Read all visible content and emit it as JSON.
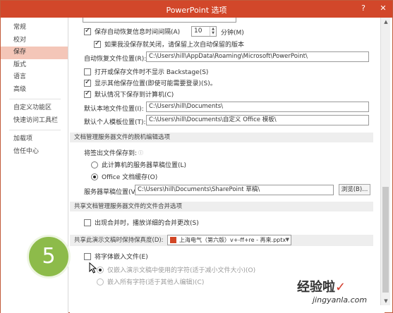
{
  "window": {
    "title": "PowerPoint 选项",
    "min_label": "?",
    "close_label": "✕"
  },
  "sidebar": {
    "items": [
      {
        "label": "常规"
      },
      {
        "label": "校对"
      },
      {
        "label": "保存"
      },
      {
        "label": "版式"
      },
      {
        "label": "语言"
      },
      {
        "label": "高级"
      },
      {
        "label": "自定义功能区"
      },
      {
        "label": "快速访问工具栏"
      },
      {
        "label": "加载项"
      },
      {
        "label": "信任中心"
      }
    ],
    "active": "保存"
  },
  "save": {
    "autorecover_label": "保存自动恢复信息时间间隔(A)",
    "autorecover_minutes": "10",
    "minutes_unit": "分钟(M)",
    "keep_last_label": "如果我没保存就关闭，请保留上次自动保留的版本",
    "autorecover_path_label": "自动恢复文件位置(R):",
    "autorecover_path": "C:\\Users\\hill\\AppData\\Roaming\\Microsoft\\PowerPoint\\",
    "no_backstage_label": "打开或保存文件时不显示 Backstage(S)",
    "show_more_locations_label": "显示其他保存位置(即使可能需要登录)(S)。",
    "save_to_computer_label": "默认情况下保存到计算机(C)",
    "default_local_label": "默认本地文件位置(I):",
    "default_local_path": "C:\\Users\\hill\\Documents\\",
    "template_label": "默认个人模板位置(T):",
    "template_path": "C:\\Users\\hill\\Documents\\自定义 Office 模板\\"
  },
  "offline": {
    "section_title": "文档管理服务器文件的脱机编辑选项",
    "save_checkout_label": "将签出文件保存到:",
    "option_server_label": "此计算机的服务器草稿位置(L)",
    "option_cache_label": "Office 文档缓存(O)",
    "server_drafts_label": "服务器草稿位置(V):",
    "server_drafts_path": "C:\\Users\\hill\\Documents\\SharePoint 草稿\\",
    "browse_label": "浏览(B)..."
  },
  "merge": {
    "section_title": "共享文档管理服务器文件的文件合并选项",
    "show_merge_label": "出现合并时，播放详细的合并更改(S)"
  },
  "fidelity": {
    "section_title": "共享此演示文稿时保持保真度(D):",
    "presentation_name": "上海电气（第六版）v+-ff+re - 再来.pptx",
    "embed_fonts_label": "将字体嵌入文件(E)",
    "embed_used_label": "仅嵌入演示文稿中使用的字符(适于减小文件大小)(O)",
    "embed_all_label": "嵌入所有字符(适于其他人编辑)(C)"
  },
  "step_badge": "5",
  "watermark": {
    "text": "经验啦",
    "check": "✓",
    "url": "jingyanla.com"
  },
  "colors": {
    "title_bar": "#d2472a",
    "sidebar_active": "#f4c6b8",
    "badge": "#8dbb4a"
  }
}
